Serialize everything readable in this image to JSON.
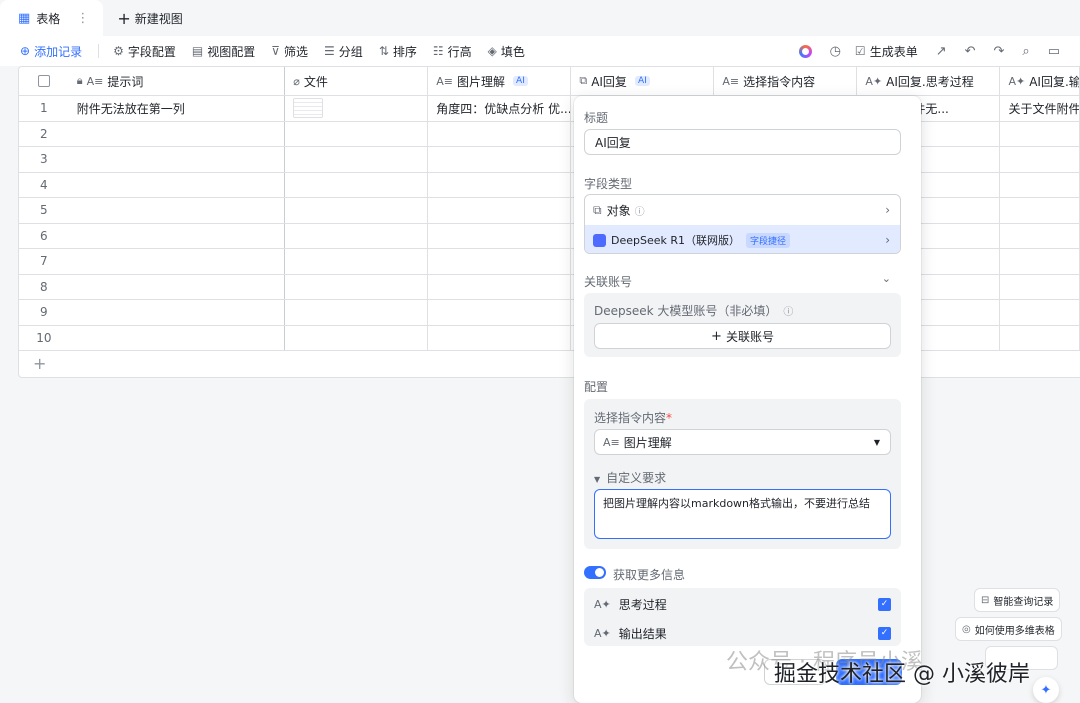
{
  "viewbar": {
    "tab_label": "表格",
    "new_view_label": "新建视图"
  },
  "toolbar": {
    "add_record": "添加记录",
    "field_config": "字段配置",
    "view_config": "视图配置",
    "filter": "筛选",
    "group": "分组",
    "sort": "排序",
    "row_height": "行高",
    "fill_color": "填色",
    "generate_form": "生成表单"
  },
  "grid": {
    "columns": [
      "提示词",
      "文件",
      "图片理解",
      "AI回复",
      "选择指令内容",
      "AI回复.思考过程",
      "AI回复.输"
    ],
    "ai_tag": "AI",
    "rows": [
      {
        "num": "1",
        "prompt": "附件无法放在第一列",
        "image_understanding": "角度四：优缺点分析 优...",
        "thinking": "户提到附件无...",
        "output": "关于文件附件"
      },
      {
        "num": "2"
      },
      {
        "num": "3"
      },
      {
        "num": "4"
      },
      {
        "num": "5"
      },
      {
        "num": "6"
      },
      {
        "num": "7"
      },
      {
        "num": "8"
      },
      {
        "num": "9"
      },
      {
        "num": "10"
      }
    ]
  },
  "panel": {
    "title_label": "标题",
    "title_value": "AI回复",
    "field_type_label": "字段类型",
    "type_object": "对象",
    "type_model": "DeepSeek R1（联网版）",
    "type_model_tag": "字段捷径",
    "linked_account_label": "关联账号",
    "account_field_label": "Deepseek 大模型账号（非必填）",
    "link_account_button": "关联账号",
    "config_label": "配置",
    "instruction_label": "选择指令内容",
    "required_mark": "*",
    "instruction_value": "图片理解",
    "custom_requirement_label": "自定义要求",
    "custom_requirement_value": "把图片理解内容以markdown格式输出，不要进行总结",
    "more_info_label": "获取更多信息",
    "option_thinking": "思考过程",
    "option_output": "输出结果"
  },
  "helpers": {
    "smart_query": "智能查询记录",
    "multi_dim": "如何使用多维表格"
  },
  "watermark": {
    "line1": "公众号 · 程序员小溪",
    "line2": "掘金技术社区 @ 小溪彼岸"
  }
}
